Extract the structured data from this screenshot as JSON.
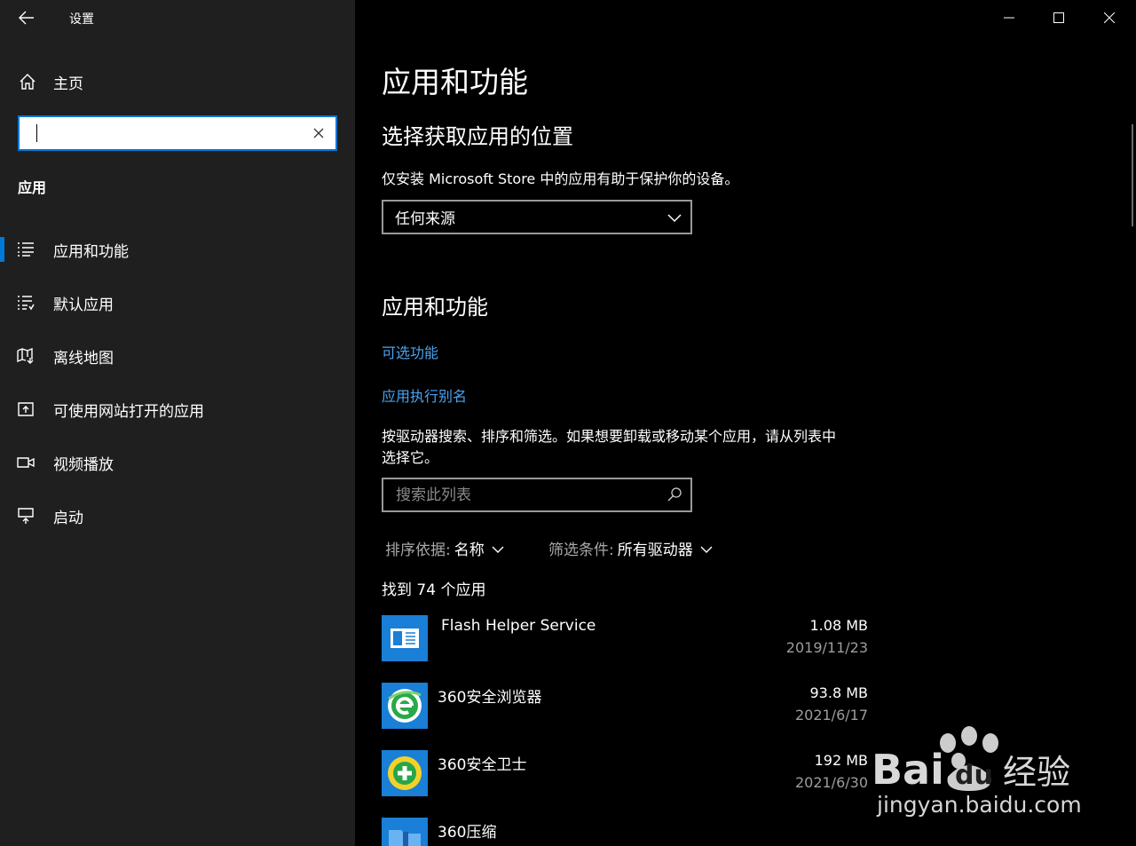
{
  "window": {
    "title": "设置"
  },
  "sidebar": {
    "home_label": "主页",
    "search": {
      "value": "",
      "placeholder": ""
    },
    "section_label": "应用",
    "items": [
      {
        "label": "应用和功能",
        "icon": "list-icon",
        "active": true
      },
      {
        "label": "默认应用",
        "icon": "default-apps-icon",
        "active": false
      },
      {
        "label": "离线地图",
        "icon": "map-icon",
        "active": false
      },
      {
        "label": "可使用网站打开的应用",
        "icon": "website-app-icon",
        "active": false
      },
      {
        "label": "视频播放",
        "icon": "video-icon",
        "active": false
      },
      {
        "label": "启动",
        "icon": "startup-icon",
        "active": false
      }
    ]
  },
  "main": {
    "title": "应用和功能",
    "source_section": {
      "heading": "选择获取应用的位置",
      "description": "仅安装 Microsoft Store 中的应用有助于保护你的设备。",
      "dropdown_value": "任何来源"
    },
    "apps_section": {
      "heading": "应用和功能",
      "link_optional": "可选功能",
      "link_alias": "应用执行别名",
      "description_line1": "按驱动器搜索、排序和筛选。如果想要卸载或移动某个应用，请从列表中",
      "description_line2": "选择它。",
      "search_placeholder": "搜索此列表",
      "sort_key": "排序依据:",
      "sort_value": "名称",
      "filter_key": "筛选条件:",
      "filter_value": "所有驱动器",
      "count_text": "找到 74 个应用",
      "apps": [
        {
          "name": "Flash Helper Service",
          "size": "1.08 MB",
          "date": "2019/11/23",
          "icon": "flash-helper-icon"
        },
        {
          "name": "360安全浏览器",
          "size": "93.8 MB",
          "date": "2021/6/17",
          "icon": "360-browser-icon"
        },
        {
          "name": "360安全卫士",
          "size": "192 MB",
          "date": "2021/6/30",
          "icon": "360-safe-icon"
        },
        {
          "name": "360压缩",
          "size": "",
          "date": "",
          "icon": "360-zip-icon"
        }
      ]
    }
  },
  "watermark": {
    "text": "jingyan.baidu.com",
    "logo_text": "Bai 经验"
  },
  "colors": {
    "accent": "#0078d7",
    "link": "#4aa3f0",
    "sidebar_bg": "#1f1f1f",
    "main_bg": "#000000"
  }
}
